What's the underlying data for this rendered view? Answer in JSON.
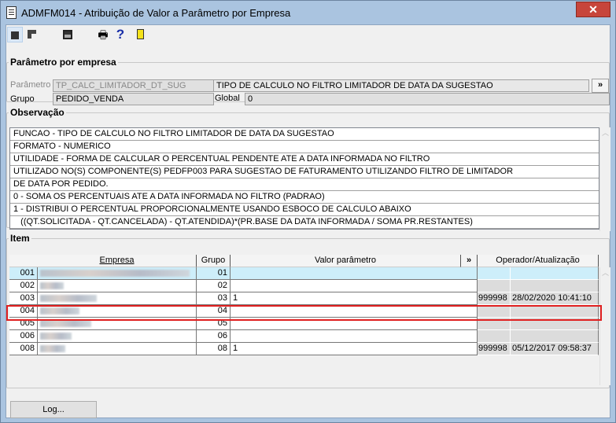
{
  "window": {
    "title": "ADMFM014 - Atribuição de Valor a Parâmetro por Empresa",
    "close": "✕"
  },
  "toolbar": [
    "navigate-icon",
    "window-icon",
    "save-icon",
    "print-icon",
    "help-icon",
    "exit-icon"
  ],
  "parametro": {
    "legend": "Parâmetro por empresa",
    "param_label": "Parâmetro",
    "param_value": "TP_CALC_LIMITADOR_DT_SUG",
    "desc": "TIPO DE CALCULO NO FILTRO LIMITADOR DE DATA DA SUGESTAO",
    "more": "»",
    "grupo_label": "Grupo",
    "grupo_value": "PEDIDO_VENDA",
    "global_label": "Global",
    "global_value": "0"
  },
  "observacao": {
    "legend": "Observação",
    "lines": [
      "FUNCAO - TIPO DE CALCULO NO FILTRO LIMITADOR DE DATA DA SUGESTAO",
      "FORMATO - NUMERICO",
      "UTILIDADE - FORMA DE CALCULAR O PERCENTUAL PENDENTE ATE A DATA INFORMADA NO FILTRO",
      "UTILIZADO NO(S) COMPONENTE(S) PEDFP003 PARA SUGESTAO DE FATURAMENTO UTILIZANDO FILTRO DE LIMITADOR",
      "DE DATA POR PEDIDO.",
      "0 - SOMA OS PERCENTUAIS ATE A DATA INFORMADA NO FILTRO (PADRAO)",
      "1 - DISTRIBUI O PERCENTUAL PROPORCIONALMENTE USANDO ESBOCO DE CALCULO ABAIXO",
      "   ((QT.SOLICITADA - QT.CANCELADA) - QT.ATENDIDA)*(PR.BASE DA DATA INFORMADA / SOMA PR.RESTANTES)"
    ]
  },
  "item": {
    "legend": "Item",
    "headers": {
      "empresa": "Empresa",
      "grupo": "Grupo",
      "valor": "Valor parâmetro",
      "more": "»",
      "operador": "Operador/Atualização"
    },
    "rows": [
      {
        "code": "001",
        "grupo": "01",
        "valor": "",
        "operador": "",
        "data": ""
      },
      {
        "code": "002",
        "grupo": "02",
        "valor": "",
        "operador": "",
        "data": ""
      },
      {
        "code": "003",
        "grupo": "03",
        "valor": "1",
        "operador": "999998",
        "data": "28/02/2020 10:41:10"
      },
      {
        "code": "004",
        "grupo": "04",
        "valor": "",
        "operador": "",
        "data": ""
      },
      {
        "code": "005",
        "grupo": "05",
        "valor": "",
        "operador": "",
        "data": ""
      },
      {
        "code": "006",
        "grupo": "06",
        "valor": "",
        "operador": "",
        "data": ""
      },
      {
        "code": "008",
        "grupo": "08",
        "valor": "1",
        "operador": "999998",
        "data": "05/12/2017 09:58:37"
      }
    ]
  },
  "log_button": "Log..."
}
